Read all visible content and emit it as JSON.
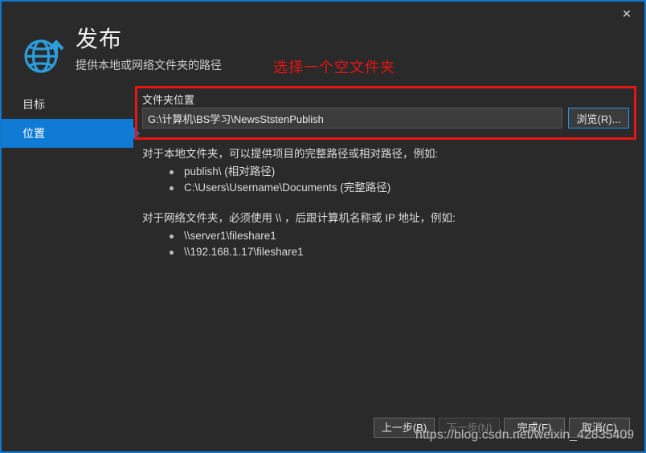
{
  "window": {
    "close_label": "✕",
    "accent_color": "#0f7bd4",
    "border_color": "#1177cc",
    "background": "#2a2a2a"
  },
  "header": {
    "icon": "globe-publish-icon",
    "title": "发布",
    "subtitle": "提供本地或网络文件夹的路径",
    "annotation": "选择一个空文件夹",
    "annotation_color": "#e81515"
  },
  "sidebar": {
    "items": [
      {
        "label": "目标",
        "active": false
      },
      {
        "label": "位置",
        "active": true
      }
    ]
  },
  "form": {
    "folder_label": "文件夹位置",
    "path_value": "G:\\计算机\\BS学习\\NewsStstenPublish",
    "path_placeholder": "",
    "browse_label": "浏览(R)..."
  },
  "description": {
    "local_intro": "对于本地文件夹，可以提供项目的完整路径或相对路径，例如:",
    "local_items": [
      "publish\\ (相对路径)",
      "C:\\Users\\Username\\Documents (完整路径)"
    ],
    "network_intro": "对于网络文件夹，必须使用 \\\\ ，后跟计算机名称或 IP 地址，例如:",
    "network_items": [
      "\\\\server1\\fileshare1",
      "\\\\192.168.1.17\\fileshare1"
    ]
  },
  "footer": {
    "back_label": "上一步(B)",
    "next_label": "下一步(N)",
    "finish_label": "完成(F)",
    "cancel_label": "取消(C)"
  },
  "watermark": "https://blog.csdn.net/weixin_42835409"
}
